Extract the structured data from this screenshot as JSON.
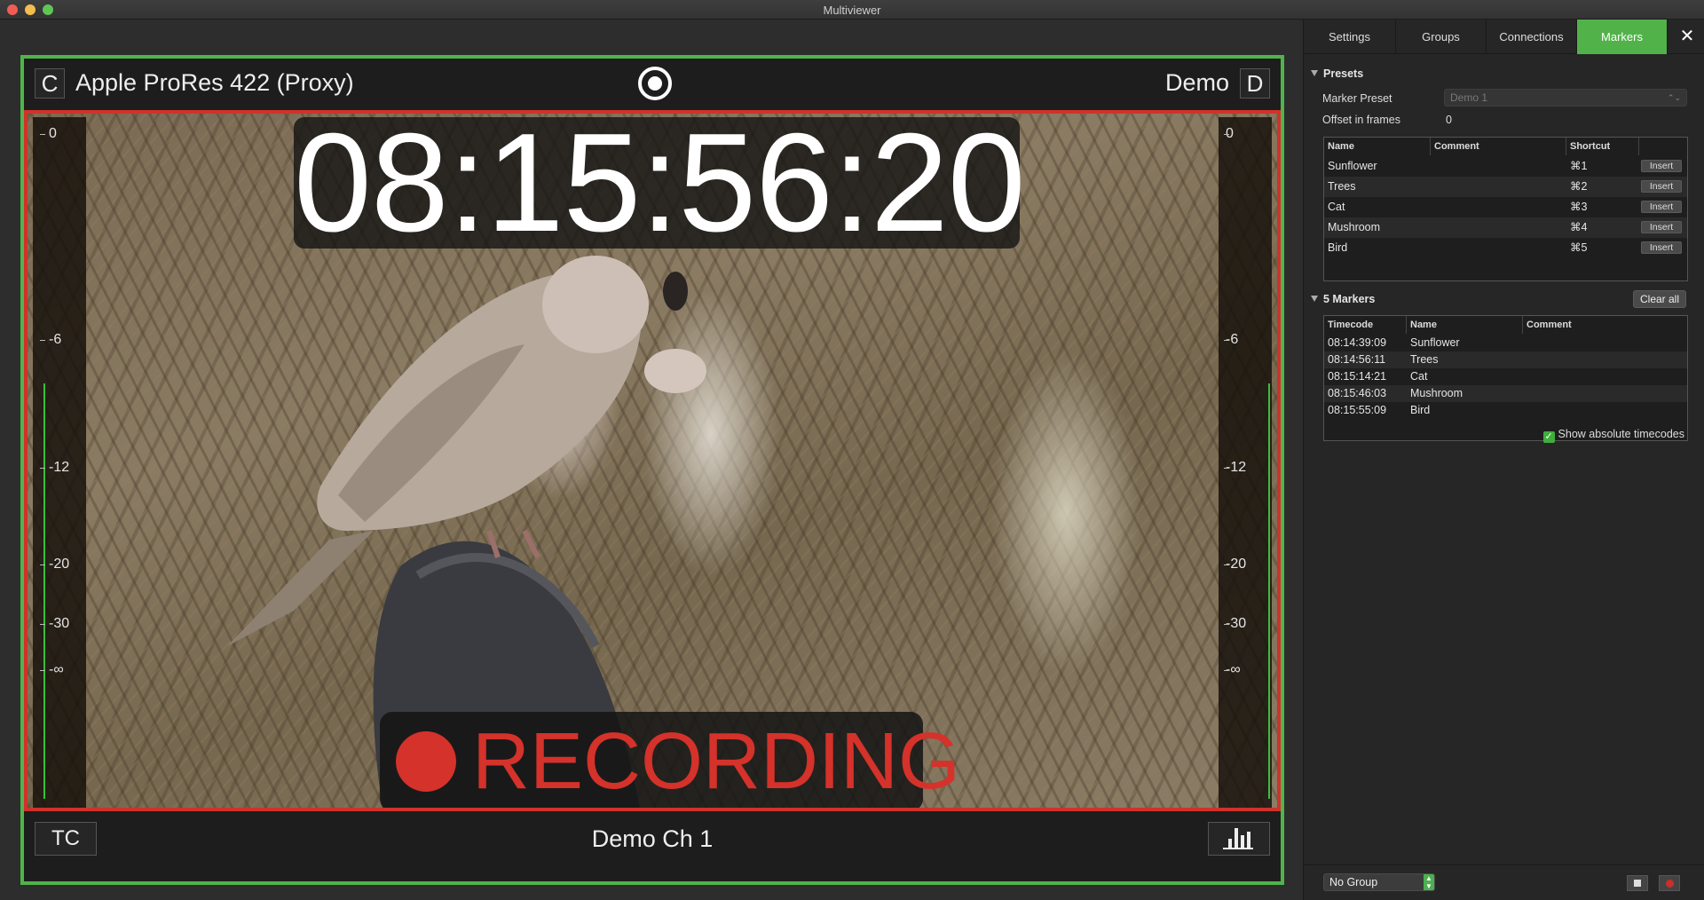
{
  "window": {
    "title": "Multiviewer"
  },
  "tile": {
    "button_left": "C",
    "source_name": "Apple ProRes 422 (Proxy)",
    "right_label": "Demo",
    "button_right": "D",
    "timecode": "08:15:56:20",
    "recording_label": "RECORDING",
    "channel_name": "Demo Ch 1",
    "tc_button": "TC",
    "meter_ticks": [
      "0",
      "-6",
      "-12",
      "-20",
      "-30",
      "-∞"
    ],
    "colors": {
      "tile_border": "#4fb54a",
      "recording_border": "#d0322b",
      "recording_red": "#d4322a"
    }
  },
  "panel": {
    "tabs": [
      "Settings",
      "Groups",
      "Connections",
      "Markers"
    ],
    "active_tab": "Markers",
    "close_icon": "✕",
    "presets": {
      "heading": "Presets",
      "marker_preset_label": "Marker Preset",
      "marker_preset_value": "Demo 1",
      "offset_label": "Offset in frames",
      "offset_value": "0",
      "columns": [
        "Name",
        "Comment",
        "Shortcut"
      ],
      "insert_label": "Insert",
      "rows": [
        {
          "name": "Sunflower",
          "comment": "",
          "shortcut": "⌘1"
        },
        {
          "name": "Trees",
          "comment": "",
          "shortcut": "⌘2"
        },
        {
          "name": "Cat",
          "comment": "",
          "shortcut": "⌘3"
        },
        {
          "name": "Mushroom",
          "comment": "",
          "shortcut": "⌘4"
        },
        {
          "name": "Bird",
          "comment": "",
          "shortcut": "⌘5"
        }
      ]
    },
    "markers": {
      "heading": "5 Markers",
      "clear_label": "Clear all",
      "columns": [
        "Timecode",
        "Name",
        "Comment"
      ],
      "rows": [
        {
          "timecode": "08:14:39:09",
          "name": "Sunflower",
          "comment": ""
        },
        {
          "timecode": "08:14:56:11",
          "name": "Trees",
          "comment": ""
        },
        {
          "timecode": "08:15:14:21",
          "name": "Cat",
          "comment": ""
        },
        {
          "timecode": "08:15:46:03",
          "name": "Mushroom",
          "comment": ""
        },
        {
          "timecode": "08:15:55:09",
          "name": "Bird",
          "comment": ""
        }
      ],
      "show_absolute_label": "Show absolute timecodes",
      "show_absolute_checked": true
    },
    "bottom": {
      "group_select_value": "No Group"
    }
  }
}
